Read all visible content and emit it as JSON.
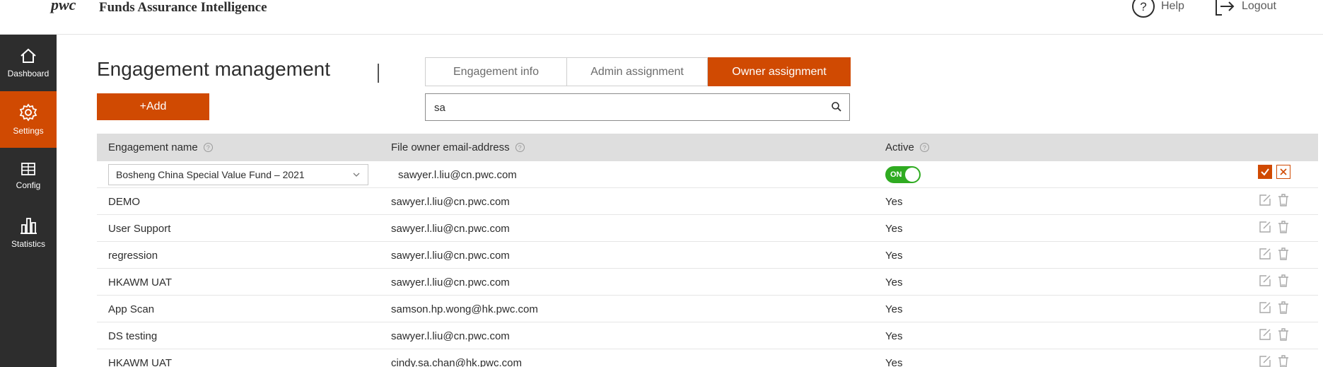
{
  "header": {
    "logo": "pwc",
    "app_title": "Funds Assurance Intelligence",
    "help_label": "Help",
    "logout_label": "Logout"
  },
  "sidebar": {
    "items": [
      {
        "label": "Dashboard",
        "icon": "home-icon",
        "active": false
      },
      {
        "label": "Settings",
        "icon": "gear-icon",
        "active": true
      },
      {
        "label": "Config",
        "icon": "table-icon",
        "active": false
      },
      {
        "label": "Statistics",
        "icon": "bar-chart-icon",
        "active": false
      }
    ]
  },
  "main": {
    "title": "Engagement management",
    "add_label": "+Add",
    "tabs": [
      {
        "label": "Engagement info",
        "active": false
      },
      {
        "label": "Admin assignment",
        "active": false
      },
      {
        "label": "Owner assignment",
        "active": true
      }
    ],
    "search": {
      "value": "sa",
      "placeholder": ""
    }
  },
  "table": {
    "columns": [
      "Engagement name",
      "File owner email-address",
      "Active"
    ],
    "edit_row": {
      "engagement": "Bosheng China Special Value Fund – 2021",
      "email": "sawyer.l.liu@cn.pwc.com",
      "toggle_label": "ON"
    },
    "rows": [
      {
        "name": "DEMO",
        "email": "sawyer.l.liu@cn.pwc.com",
        "active": "Yes"
      },
      {
        "name": "User Support",
        "email": "sawyer.l.liu@cn.pwc.com",
        "active": "Yes"
      },
      {
        "name": "regression",
        "email": "sawyer.l.liu@cn.pwc.com",
        "active": "Yes"
      },
      {
        "name": "HKAWM UAT",
        "email": "sawyer.l.liu@cn.pwc.com",
        "active": "Yes"
      },
      {
        "name": "App Scan",
        "email": "samson.hp.wong@hk.pwc.com",
        "active": "Yes"
      },
      {
        "name": "DS testing",
        "email": "sawyer.l.liu@cn.pwc.com",
        "active": "Yes"
      },
      {
        "name": "HKAWM UAT",
        "email": "cindy.sa.chan@hk.pwc.com",
        "active": "Yes"
      }
    ]
  },
  "colors": {
    "accent": "#d04a02",
    "sidebar": "#2d2d2d",
    "toggle_on": "#2fab21",
    "header_row": "#dedede"
  }
}
